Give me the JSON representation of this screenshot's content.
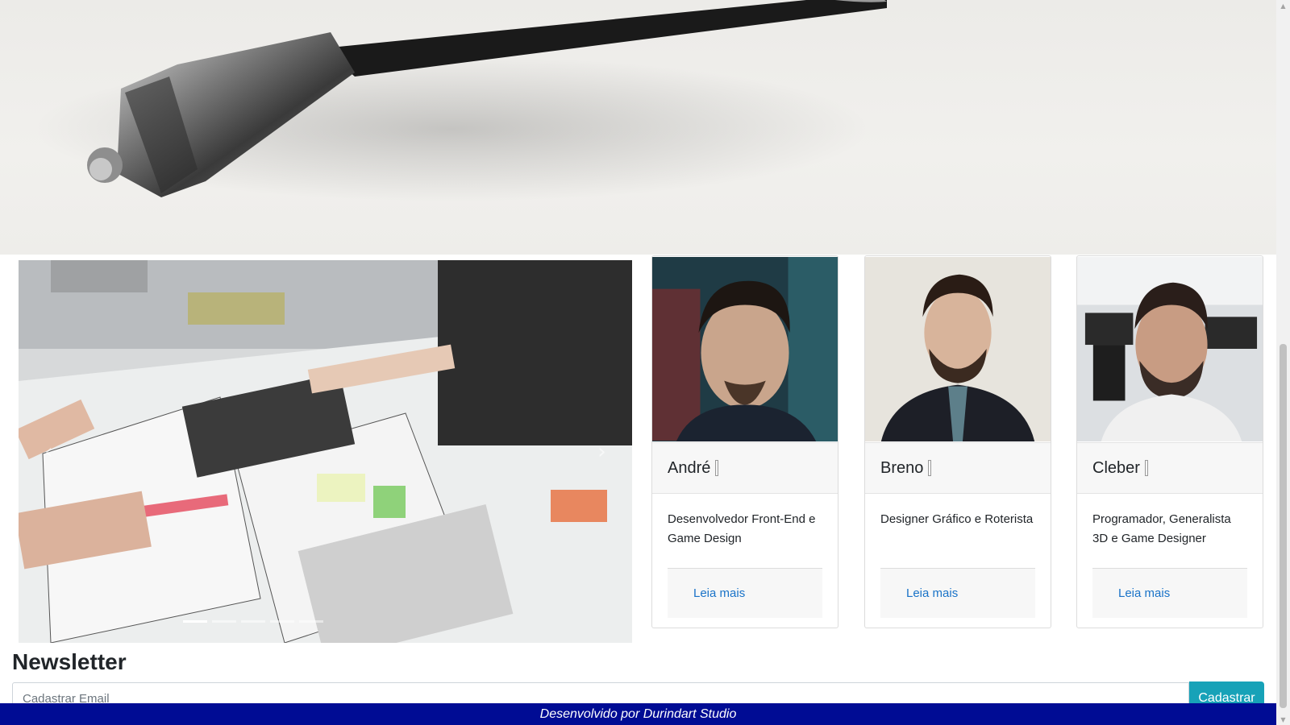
{
  "carousel": {
    "prev_icon": "‹",
    "next_icon": "›",
    "indicator_count": 5,
    "active_index": 0
  },
  "cards": [
    {
      "name": "André",
      "description": "Desenvolvedor Front-End e Game Design",
      "link": "Leia mais"
    },
    {
      "name": "Breno",
      "description": "Designer Gráfico e Roterista",
      "link": "Leia mais"
    },
    {
      "name": "Cleber",
      "description": "Programador, Generalista 3D e Game Designer",
      "link": "Leia mais"
    }
  ],
  "newsletter": {
    "title": "Newsletter",
    "placeholder": "Cadastrar Email",
    "button": "Cadastrar"
  },
  "footer": {
    "text": "Desenvolvido por Durindart Studio"
  },
  "colors": {
    "footer_bg": "#000c94",
    "button_bg": "#17a2b8",
    "link": "#1a73c8"
  }
}
